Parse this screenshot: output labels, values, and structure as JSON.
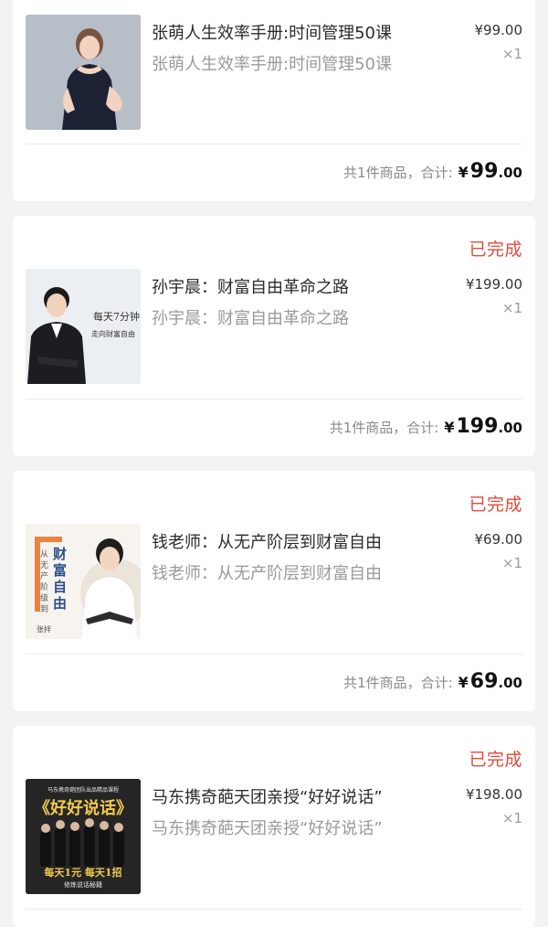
{
  "orders": [
    {
      "status": "",
      "title": "张萌人生效率手册:时间管理50课",
      "subtitle": "张萌人生效率手册:时间管理50课",
      "price": "¥99.00",
      "qty": "×1",
      "summary_label": "共1件商品，合计:",
      "total_currency": "¥",
      "total_int": "99",
      "total_dec": ".00"
    },
    {
      "status": "已完成",
      "title": "孙宇晨：财富自由革命之路",
      "subtitle": "孙宇晨：财富自由革命之路",
      "price": "¥199.00",
      "qty": "×1",
      "summary_label": "共1件商品，合计:",
      "total_currency": "¥",
      "total_int": "199",
      "total_dec": ".00",
      "thumb_text": [
        "每天7分钟",
        "走向财富自由"
      ]
    },
    {
      "status": "已完成",
      "title": "钱老师：从无产阶层到财富自由",
      "subtitle": "钱老师：从无产阶层到财富自由",
      "price": "¥69.00",
      "qty": "×1",
      "summary_label": "共1件商品，合计:",
      "total_currency": "¥",
      "total_int": "69",
      "total_dec": ".00",
      "thumb_text": [
        "从无产阶级到",
        "财富自由",
        "张拌"
      ]
    },
    {
      "status": "已完成",
      "title": "马东携奇葩天团亲授“好好说话”",
      "subtitle": "马东携奇葩天团亲授“好好说话”",
      "price": "¥198.00",
      "qty": "×1",
      "thumb_text": [
        "马东携奇葩团队出品精品课程",
        "《好好说话》",
        "每天1元 每天1招",
        "修炼说话秘籍"
      ]
    }
  ],
  "colors": {
    "status": "#e24a3b",
    "background": "#f3f3f3",
    "card": "#ffffff"
  }
}
